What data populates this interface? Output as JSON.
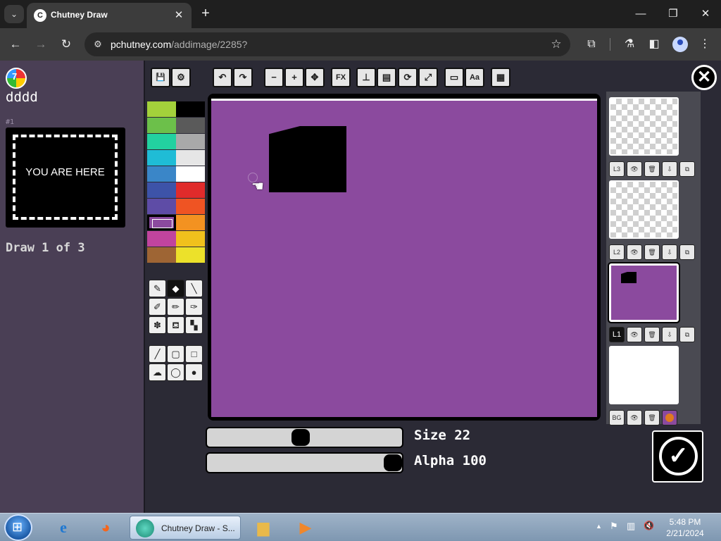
{
  "browser": {
    "tab_title": "Chutney Draw",
    "tab_favicon": "chutney-favicon",
    "tab_close": "✕",
    "new_tab": "+",
    "tab_list": "⌄",
    "window_minimize": "—",
    "window_restore": "❐",
    "window_close": "✕",
    "url_host": "pchutney.com",
    "url_path": "/addimage/2285?",
    "back": "←",
    "forward": "→",
    "reload": "↻",
    "site_info": "⚙",
    "bookmark": "☆",
    "extensions": "⧉",
    "labs": "⚗",
    "side_panel": "◧",
    "menu": "⋮"
  },
  "sidebar": {
    "logo_text": "7",
    "username": "dddd",
    "entry_number": "#1",
    "you_are_here": "YOU ARE HERE",
    "draw_count": "Draw 1 of 3"
  },
  "toolbar": {
    "buttons": [
      {
        "name": "save",
        "icon": "💾"
      },
      {
        "name": "settings",
        "icon": "⚙"
      },
      {
        "name": "undo",
        "icon": "↶"
      },
      {
        "name": "redo",
        "icon": "↷"
      },
      {
        "name": "zoom-out",
        "icon": "−"
      },
      {
        "name": "zoom-in",
        "icon": "+"
      },
      {
        "name": "move",
        "icon": "✥"
      },
      {
        "name": "fx",
        "icon": "FX"
      },
      {
        "name": "stamp",
        "icon": "⊥"
      },
      {
        "name": "reference",
        "icon": "▤"
      },
      {
        "name": "rotate",
        "icon": "⟳"
      },
      {
        "name": "resize",
        "icon": "⤢"
      },
      {
        "name": "text-box",
        "icon": "▭"
      },
      {
        "name": "text",
        "icon": "Aa"
      },
      {
        "name": "transparency",
        "icon": "▦"
      }
    ],
    "close_icon": "✕"
  },
  "palette": {
    "colors": [
      "#a3d13b",
      "#000000",
      "#6cc04a",
      "#5a5a5a",
      "#22d1a0",
      "#a9a9a9",
      "#1fbcd6",
      "#e6e6e6",
      "#3a86c8",
      "#ffffff",
      "#3d53a8",
      "#e02b2b",
      "#5e4ca6",
      "#ef5423",
      "#8b4a9e",
      "#f39221",
      "#c1449e",
      "#f0c11c",
      "#9e6534",
      "#ece12a"
    ],
    "selected_index": 14
  },
  "brushes": [
    {
      "name": "brush-tool",
      "icon": "✎",
      "active": false
    },
    {
      "name": "eraser-tool",
      "icon": "◆",
      "active": true
    },
    {
      "name": "pen-tool",
      "icon": "╲",
      "active": false
    },
    {
      "name": "paint-tool",
      "icon": "✐",
      "active": false
    },
    {
      "name": "pencil-tool",
      "icon": "✏",
      "active": false
    },
    {
      "name": "marker-tool",
      "icon": "✑",
      "active": false
    },
    {
      "name": "spray-tool",
      "icon": "✽",
      "active": false
    },
    {
      "name": "fill-tool",
      "icon": "⛾",
      "active": false
    },
    {
      "name": "pattern-tool",
      "icon": "▚",
      "active": false
    },
    {
      "name": "line-tool",
      "icon": "╱",
      "active": false
    },
    {
      "name": "rect-outline-tool",
      "icon": "▢",
      "active": false
    },
    {
      "name": "rect-fill-tool",
      "icon": "□",
      "active": false
    },
    {
      "name": "lasso-tool",
      "icon": "☁",
      "active": false
    },
    {
      "name": "circle-outline-tool",
      "icon": "◯",
      "active": false
    },
    {
      "name": "circle-fill-tool",
      "icon": "●",
      "active": false
    }
  ],
  "canvas": {
    "background_color": "#8b4a9e",
    "cursor_icon": "☚"
  },
  "sliders": {
    "size_label": "Size 22",
    "size_value": 22,
    "size_fraction": 0.48,
    "alpha_label": "Alpha 100",
    "alpha_value": 100,
    "alpha_fraction": 1.0
  },
  "layers": [
    {
      "label": "L3",
      "type": "transparent",
      "active": false
    },
    {
      "label": "L2",
      "type": "transparent",
      "active": false
    },
    {
      "label": "L1",
      "type": "drawing",
      "active": true
    },
    {
      "label": "BG",
      "type": "white",
      "active": false
    }
  ],
  "layer_controls": {
    "visibility": "👁",
    "delete": "🗑",
    "merge_down": "⇩",
    "copy": "⧉"
  },
  "submit_icon": "✓",
  "taskbar": {
    "start_icon": "⊞",
    "ie_icon": "e",
    "firefox_icon": "◕",
    "active_app_label": "Chutney Draw - S...",
    "explorer_icon": "▆",
    "media_icon": "▶",
    "tray_arrow": "▲",
    "flag_icon": "⚑",
    "network_icon": "▥",
    "volume_icon": "🔇",
    "time": "5:48 PM",
    "date": "2/21/2024"
  }
}
